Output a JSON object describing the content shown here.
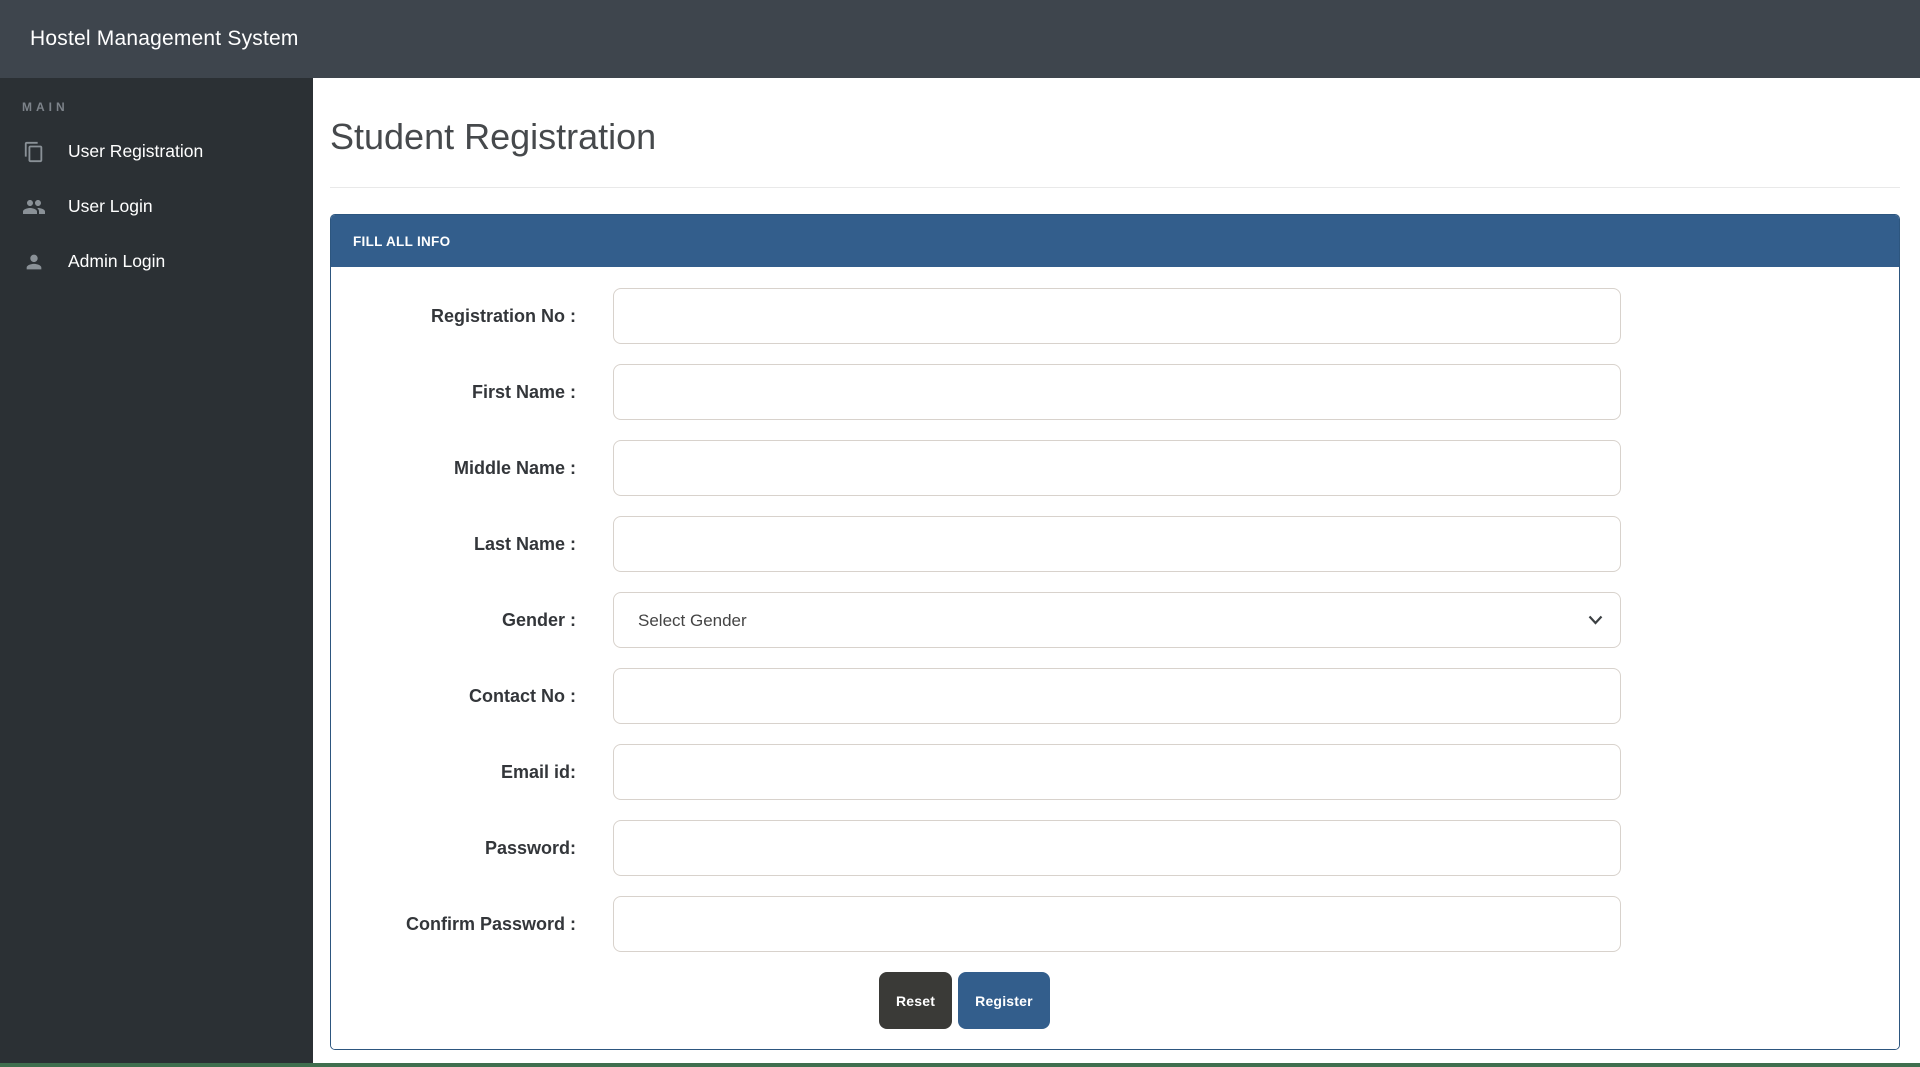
{
  "navbar": {
    "title": "Hostel Management System",
    "bg_color": "#3e454d"
  },
  "sidebar": {
    "section_label": "MAIN",
    "bg_color": "#2b3034",
    "items": [
      {
        "label": "User Registration",
        "icon": "copy-pages-icon"
      },
      {
        "label": "User Login",
        "icon": "users-group-icon"
      },
      {
        "label": "Admin Login",
        "icon": "person-icon"
      }
    ]
  },
  "main": {
    "page_title": "Student Registration",
    "panel": {
      "header_title": "FILL ALL INFO",
      "accent_color": "#335e8c",
      "fields": [
        {
          "label": "Registration No :",
          "type": "text",
          "value": ""
        },
        {
          "label": "First Name :",
          "type": "text",
          "value": ""
        },
        {
          "label": "Middle Name :",
          "type": "text",
          "value": ""
        },
        {
          "label": "Last Name :",
          "type": "text",
          "value": ""
        },
        {
          "label": "Gender :",
          "type": "select",
          "selected_option": "Select Gender"
        },
        {
          "label": "Contact No :",
          "type": "text",
          "value": ""
        },
        {
          "label": "Email id:",
          "type": "text",
          "value": ""
        },
        {
          "label": "Password:",
          "type": "password",
          "value": ""
        },
        {
          "label": "Confirm Password :",
          "type": "password",
          "value": ""
        }
      ],
      "buttons": [
        {
          "label": "Reset",
          "color": "#3a3a37"
        },
        {
          "label": "Register",
          "color": "#335e8c"
        }
      ]
    }
  },
  "footer": {
    "strip_color": "#3f6e4e"
  }
}
